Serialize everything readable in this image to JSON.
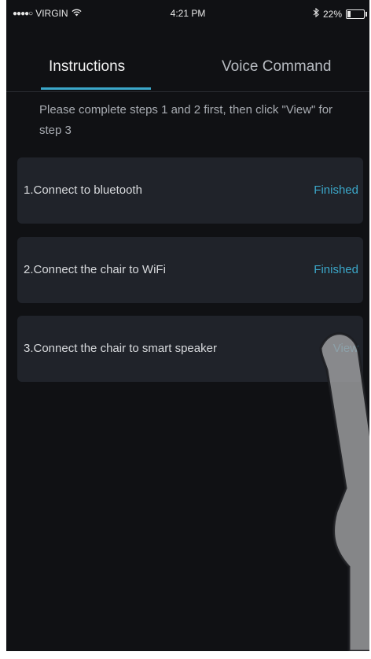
{
  "status_bar": {
    "signal_dots": "●●●●○",
    "carrier": "VIRGIN",
    "wifi_icon": "wifi-icon",
    "time": "4:21 PM",
    "bluetooth_icon": "bluetooth-icon",
    "battery_percent": "22%",
    "battery_level": 0.22
  },
  "tabs": {
    "instructions_label": "Instructions",
    "voice_command_label": "Voice Command",
    "active": "Instructions",
    "accent_color": "#3ba7c9"
  },
  "notice": "Please complete steps 1 and 2 first, then click \"View\" for step 3",
  "steps": [
    {
      "label": "1.Connect to bluetooth",
      "action": "Finished"
    },
    {
      "label": "2.Connect the chair to WiFi",
      "action": "Finished"
    },
    {
      "label": "3.Connect the chair to smart speaker",
      "action": "View"
    }
  ]
}
